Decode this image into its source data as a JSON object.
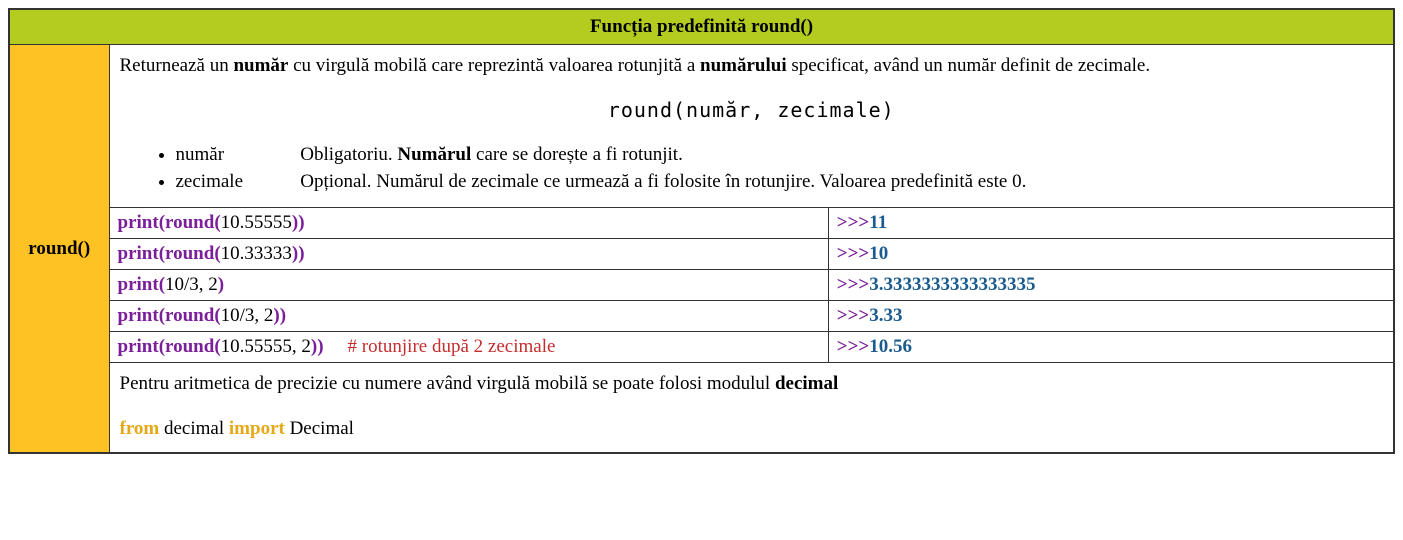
{
  "title": "Funcția predefinită round()",
  "side_label": "round()",
  "description": {
    "p1a": "Returnează un ",
    "p1b": "număr",
    "p1c": " cu virgulă mobilă care reprezintă valoarea rotunjită a ",
    "p1d": "numărului",
    "p1e": " specificat, având un număr definit de zecimale."
  },
  "signature": "round(număr, zecimale)",
  "params": [
    {
      "name": "număr",
      "desc_pre": "Obligatoriu. ",
      "desc_bold": "Numărul",
      "desc_post": " care se dorește a fi rotunjit."
    },
    {
      "name": "zecimale",
      "desc_pre": "Opțional. Numărul de zecimale ce urmează a fi folosite în rotunjire. Valoarea predefinită este 0.",
      "desc_bold": "",
      "desc_post": ""
    }
  ],
  "rows": [
    {
      "print": "print",
      "round": "round",
      "open1": "(",
      "open2": "(",
      "args": "10.55555",
      "close2": ")",
      "close1": ")",
      "comment": "",
      "out": "11"
    },
    {
      "print": "print",
      "round": "round",
      "open1": "(",
      "open2": "(",
      "args": "10.33333",
      "close2": ")",
      "close1": ")",
      "comment": "",
      "out": "10"
    },
    {
      "print": "print",
      "round": "",
      "open1": "(",
      "open2": "",
      "args": "10/3, 2",
      "close2": "",
      "close1": ")",
      "comment": "",
      "out": "3.3333333333333335"
    },
    {
      "print": "print",
      "round": "round",
      "open1": "(",
      "open2": "(",
      "args": "10/3, 2",
      "close2": ")",
      "close1": ")",
      "comment": "",
      "out": "3.33"
    },
    {
      "print": "print",
      "round": "round",
      "open1": "(",
      "open2": "(",
      "args": "10.55555, 2",
      "close2": ")",
      "close1": ")",
      "comment": "# rotunjire după 2 zecimale",
      "out": "10.56"
    }
  ],
  "chev": ">>>",
  "footer": {
    "p1a": "Pentru aritmetica de precizie cu numere având virgulă mobilă se poate folosi modulul ",
    "p1b": "decimal",
    "from": "from",
    "mod": " decimal ",
    "import": "import",
    "cls": " Decimal"
  }
}
